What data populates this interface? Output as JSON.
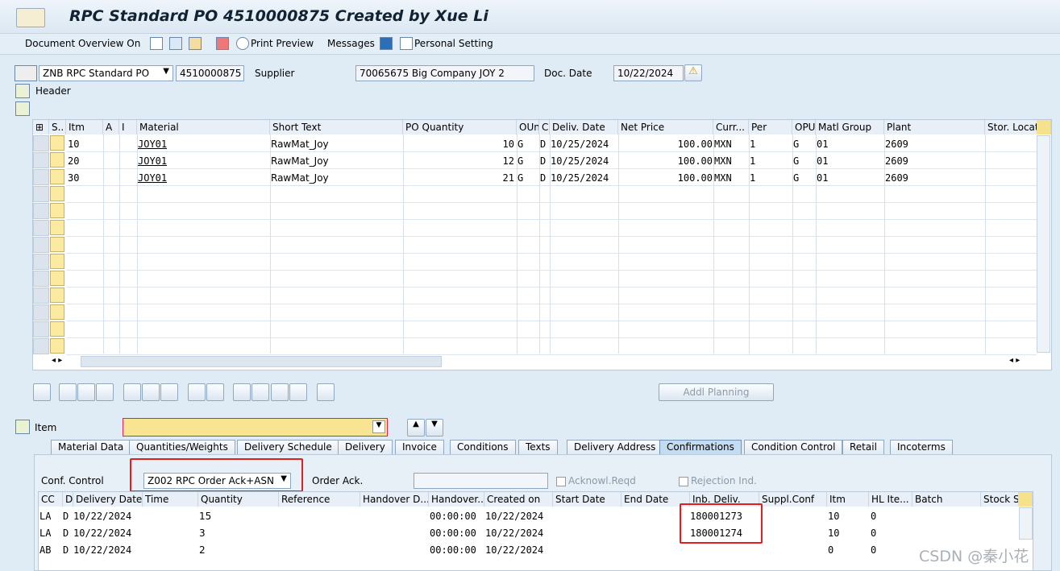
{
  "title": {
    "text": "RPC Standard PO 4510000875 Created by Xue Li"
  },
  "toolbar": {
    "doc_overview": "Document Overview On",
    "print_preview": "Print Preview",
    "messages": "Messages",
    "personal_setting": "Personal Setting"
  },
  "header": {
    "po_type": "ZNB RPC Standard PO",
    "po_number": "4510000875",
    "supplier_label": "Supplier",
    "supplier_value": "70065675 Big Company JOY 2",
    "doc_date_label": "Doc. Date",
    "doc_date_value": "10/22/2024",
    "header_label": "Header"
  },
  "items_table": {
    "columns": [
      "S..",
      "Itm",
      "A",
      "I",
      "Material",
      "Short Text",
      "PO Quantity",
      "OUn",
      "C",
      "Deliv. Date",
      "Net Price",
      "Curr...",
      "Per",
      "OPU",
      "Matl Group",
      "Plant",
      "Stor. Locat"
    ],
    "rows": [
      {
        "itm": "10",
        "material": "JOY01",
        "short_text": "RawMat_Joy",
        "qty": "10",
        "oun": "G",
        "c": "D",
        "deliv": "10/25/2024",
        "price": "100.00",
        "curr": "MXN",
        "per": "1",
        "opu": "G",
        "matl_group": "01",
        "plant": "2609"
      },
      {
        "itm": "20",
        "material": "JOY01",
        "short_text": "RawMat_Joy",
        "qty": "12",
        "oun": "G",
        "c": "D",
        "deliv": "10/25/2024",
        "price": "100.00",
        "curr": "MXN",
        "per": "1",
        "opu": "G",
        "matl_group": "01",
        "plant": "2609"
      },
      {
        "itm": "30",
        "material": "JOY01",
        "short_text": "RawMat_Joy",
        "qty": "21",
        "oun": "G",
        "c": "D",
        "deliv": "10/25/2024",
        "price": "100.00",
        "curr": "MXN",
        "per": "1",
        "opu": "G",
        "matl_group": "01",
        "plant": "2609"
      }
    ]
  },
  "addl_planning": "Addl Planning",
  "item_section": {
    "label": "Item",
    "value": ""
  },
  "tabs": [
    "Material Data",
    "Quantities/Weights",
    "Delivery Schedule",
    "Delivery",
    "Invoice",
    "Conditions",
    "Texts",
    "Delivery Address",
    "Confirmations",
    "Condition Control",
    "Retail",
    "Incoterms"
  ],
  "confirmations": {
    "conf_control_label": "Conf. Control",
    "conf_control_value": "Z002 RPC Order Ack+ASN",
    "order_ack_label": "Order Ack.",
    "order_ack_value": "",
    "ack_reqd": "Acknowl.Reqd",
    "rejection": "Rejection Ind.",
    "columns": [
      "CC",
      "D",
      "Delivery Date",
      "Time",
      "Quantity",
      "Reference",
      "Handover D...",
      "Handover...",
      "Created on",
      "Start Date",
      "End Date",
      "Inb. Deliv.",
      "Suppl.Conf",
      "Itm",
      "HL Ite...",
      "Batch",
      "Stock S"
    ],
    "rows": [
      {
        "cc": "LA",
        "d": "D",
        "date": "10/22/2024",
        "qty": "15",
        "handover": "00:00:00",
        "created": "10/22/2024",
        "inb": "180001273",
        "itm": "10",
        "hl": "0"
      },
      {
        "cc": "LA",
        "d": "D",
        "date": "10/22/2024",
        "qty": "3",
        "handover": "00:00:00",
        "created": "10/22/2024",
        "inb": "180001274",
        "itm": "10",
        "hl": "0"
      },
      {
        "cc": "AB",
        "d": "D",
        "date": "10/22/2024",
        "qty": "2",
        "handover": "00:00:00",
        "created": "10/22/2024",
        "inb": "",
        "itm": "0",
        "hl": "0"
      }
    ]
  },
  "watermark": "CSDN @秦小花",
  "colors": {
    "accent_red": "#e02020",
    "highlight_yellow": "#fbeaa0",
    "active_tab": "#c4dcf1"
  }
}
